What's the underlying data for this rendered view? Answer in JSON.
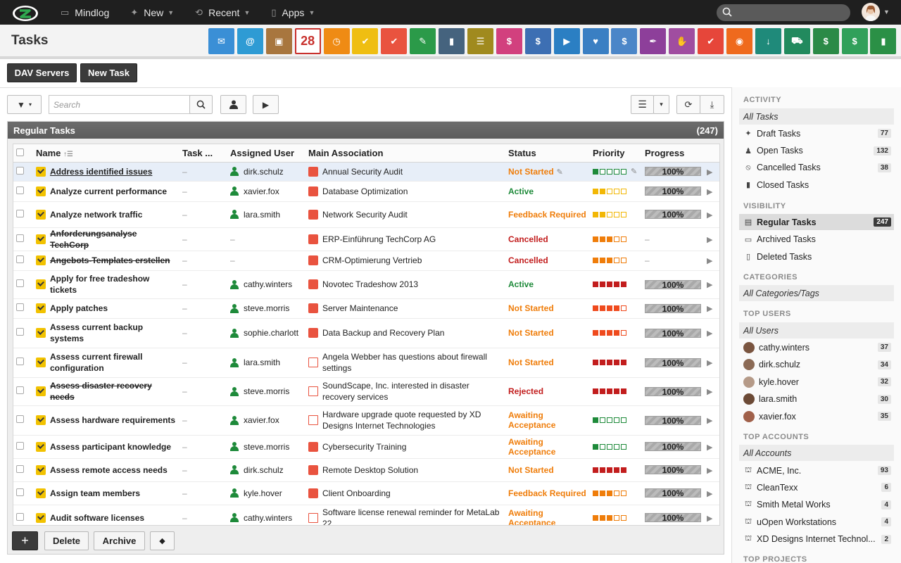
{
  "topbar": {
    "nav": [
      {
        "label": "Mindlog",
        "icon": "monitor-icon",
        "caret": false
      },
      {
        "label": "New",
        "icon": "sparkle-icon",
        "caret": true
      },
      {
        "label": "Recent",
        "icon": "history-icon",
        "caret": true
      },
      {
        "label": "Apps",
        "icon": "tablet-icon",
        "caret": true
      }
    ],
    "search_placeholder": ""
  },
  "header": {
    "title": "Tasks",
    "apps": [
      {
        "name": "mail-app-icon",
        "color": "#3a8fd6",
        "glyph": "✉"
      },
      {
        "name": "address-app-icon",
        "color": "#2e9bd4",
        "glyph": "@"
      },
      {
        "name": "contacts-app-icon",
        "color": "#a8763e",
        "glyph": "▣"
      },
      {
        "name": "calendar-app-icon",
        "color": "#c8302c",
        "glyph": "28"
      },
      {
        "name": "timer-app-icon",
        "color": "#ef8b14",
        "glyph": "◷"
      },
      {
        "name": "tasks-app-icon",
        "color": "#efbe12",
        "glyph": "✔"
      },
      {
        "name": "projects-app-icon",
        "color": "#e9533f",
        "glyph": "✔"
      },
      {
        "name": "notes-app-icon",
        "color": "#2b9a49",
        "glyph": "✎"
      },
      {
        "name": "bookmarks-app-icon",
        "color": "#45637e",
        "glyph": "▮"
      },
      {
        "name": "docs-app-icon",
        "color": "#a08a1e",
        "glyph": "☰"
      },
      {
        "name": "helpdesk-app-icon",
        "color": "#d2407e",
        "glyph": "$"
      },
      {
        "name": "finance-app-icon",
        "color": "#3d6fb3",
        "glyph": "$"
      },
      {
        "name": "shipping-app-icon",
        "color": "#2b7fc3",
        "glyph": "▶"
      },
      {
        "name": "support-app-icon",
        "color": "#3a7fc3",
        "glyph": "♥"
      },
      {
        "name": "money-app-icon",
        "color": "#4b86c8",
        "glyph": "$"
      },
      {
        "name": "contracts-app-icon",
        "color": "#8d3f9a",
        "glyph": "✒"
      },
      {
        "name": "deals-app-icon",
        "color": "#a04da0",
        "glyph": "✋"
      },
      {
        "name": "quotes-app-icon",
        "color": "#e6463a",
        "glyph": "✔"
      },
      {
        "name": "broadcast-app-icon",
        "color": "#ef6a1d",
        "glyph": "◉"
      },
      {
        "name": "downloads-app-icon",
        "color": "#1f8a7a",
        "glyph": "↓"
      },
      {
        "name": "shop-app-icon",
        "color": "#228a5e",
        "glyph": "⛟"
      },
      {
        "name": "cash-app-icon",
        "color": "#2b8a47",
        "glyph": "$"
      },
      {
        "name": "pricing-app-icon",
        "color": "#31a05a",
        "glyph": "$"
      },
      {
        "name": "database-app-icon",
        "color": "#2b9046",
        "glyph": "▮"
      }
    ]
  },
  "toolbar": {
    "dav_label": "DAV Servers",
    "new_task_label": "New Task",
    "search_placeholder": "Search"
  },
  "panel": {
    "title": "Regular Tasks",
    "count": "(247)"
  },
  "table": {
    "headers": {
      "name": "Name",
      "task": "Task ...",
      "user": "Assigned User",
      "assoc": "Main Association",
      "status": "Status",
      "priority": "Priority",
      "progress": "Progress"
    },
    "rows": [
      {
        "name": "Address identified issues",
        "style": "ul",
        "task": "–",
        "user": "dirk.schulz",
        "assoc": "Annual Security Audit",
        "assoc_type": "project",
        "status": "Not Started",
        "status_color": "#ef7d0a",
        "priority": 1,
        "prio_color": "#1e8a3a",
        "progress": "100%",
        "selected": true,
        "pencil": true
      },
      {
        "name": "Analyze current performance",
        "style": "",
        "task": "–",
        "user": "xavier.fox",
        "assoc": "Database Optimization",
        "assoc_type": "project",
        "status": "Active",
        "status_color": "#1e8a3a",
        "priority": 2,
        "prio_color": "#f2b705",
        "progress": "100%"
      },
      {
        "name": "Analyze network traffic",
        "style": "",
        "task": "–",
        "user": "lara.smith",
        "assoc": "Network Security Audit",
        "assoc_type": "project",
        "status": "Feedback Required",
        "status_color": "#ef7d0a",
        "priority": 2,
        "prio_color": "#f2b705",
        "progress": "100%"
      },
      {
        "name": "Anforderungsanalyse TechCorp",
        "style": "st",
        "task": "–",
        "user": "–",
        "assoc": "ERP-Einführung TechCorp AG",
        "assoc_type": "project",
        "status": "Cancelled",
        "status_color": "#c21d1d",
        "priority": 3,
        "prio_color": "#ef7d0a",
        "progress": "–"
      },
      {
        "name": "Angebots-Templates erstellen",
        "style": "st",
        "task": "–",
        "user": "–",
        "assoc": "CRM-Optimierung Vertrieb",
        "assoc_type": "project",
        "status": "Cancelled",
        "status_color": "#c21d1d",
        "priority": 3,
        "prio_color": "#ef7d0a",
        "progress": "–"
      },
      {
        "name": "Apply for free tradeshow tickets",
        "style": "",
        "task": "–",
        "user": "cathy.winters",
        "assoc": "Novotec Tradeshow 2013",
        "assoc_type": "project",
        "status": "Active",
        "status_color": "#1e8a3a",
        "priority": 5,
        "prio_color": "#c21d1d",
        "progress": "100%"
      },
      {
        "name": "Apply patches",
        "style": "",
        "task": "–",
        "user": "steve.morris",
        "assoc": "Server Maintenance",
        "assoc_type": "project",
        "status": "Not Started",
        "status_color": "#ef7d0a",
        "priority": 4,
        "prio_color": "#ef4a1d",
        "progress": "100%"
      },
      {
        "name": "Assess current backup systems",
        "style": "",
        "task": "–",
        "user": "sophie.charlott",
        "assoc": "Data Backup and Recovery Plan",
        "assoc_type": "project",
        "status": "Not Started",
        "status_color": "#ef7d0a",
        "priority": 4,
        "prio_color": "#ef4a1d",
        "progress": "100%"
      },
      {
        "name": "Assess current firewall configuration",
        "style": "",
        "task": "–",
        "user": "lara.smith",
        "assoc": "Angela Webber has questions about firewall settings",
        "assoc_type": "doc",
        "status": "Not Started",
        "status_color": "#ef7d0a",
        "priority": 5,
        "prio_color": "#c21d1d",
        "progress": "100%"
      },
      {
        "name": "Assess disaster recovery needs",
        "style": "st",
        "task": "–",
        "user": "steve.morris",
        "assoc": "SoundScape, Inc. interested in disaster recovery services",
        "assoc_type": "doc",
        "status": "Rejected",
        "status_color": "#c21d1d",
        "priority": 5,
        "prio_color": "#c21d1d",
        "progress": "100%"
      },
      {
        "name": "Assess hardware requirements",
        "style": "",
        "task": "–",
        "user": "xavier.fox",
        "assoc": "Hardware upgrade quote requested by XD Designs Internet Technologies",
        "assoc_type": "doc",
        "status": "Awaiting Acceptance",
        "status_color": "#ef7d0a",
        "priority": 1,
        "prio_color": "#1e8a3a",
        "progress": "100%"
      },
      {
        "name": "Assess participant knowledge",
        "style": "",
        "task": "–",
        "user": "steve.morris",
        "assoc": "Cybersecurity Training",
        "assoc_type": "project",
        "status": "Awaiting Acceptance",
        "status_color": "#ef7d0a",
        "priority": 1,
        "prio_color": "#1e8a3a",
        "progress": "100%"
      },
      {
        "name": "Assess remote access needs",
        "style": "",
        "task": "–",
        "user": "dirk.schulz",
        "assoc": "Remote Desktop Solution",
        "assoc_type": "project",
        "status": "Not Started",
        "status_color": "#ef7d0a",
        "priority": 5,
        "prio_color": "#c21d1d",
        "progress": "100%"
      },
      {
        "name": "Assign team members",
        "style": "",
        "task": "–",
        "user": "kyle.hover",
        "assoc": "Client Onboarding",
        "assoc_type": "project",
        "status": "Feedback Required",
        "status_color": "#ef7d0a",
        "priority": 3,
        "prio_color": "#ef7d0a",
        "progress": "100%"
      },
      {
        "name": "Audit software licenses",
        "style": "",
        "task": "–",
        "user": "cathy.winters",
        "assoc": "Software license renewal reminder for MetaLab 22",
        "assoc_type": "doc",
        "status": "Awaiting Acceptance",
        "status_color": "#ef7d0a",
        "priority": 3,
        "prio_color": "#ef7d0a",
        "progress": "100%"
      }
    ]
  },
  "bottom": {
    "add": "+",
    "delete": "Delete",
    "archive": "Archive"
  },
  "sidebar": {
    "activity_label": "ACTIVITY",
    "activity": [
      {
        "label": "All Tasks",
        "kind": "all"
      },
      {
        "label": "Draft Tasks",
        "count": "77",
        "icon": "✦"
      },
      {
        "label": "Open Tasks",
        "count": "132",
        "icon": "♟"
      },
      {
        "label": "Cancelled Tasks",
        "count": "38",
        "icon": "⦸"
      },
      {
        "label": "Closed Tasks",
        "icon": "▮"
      }
    ],
    "visibility_label": "VISIBILITY",
    "visibility": [
      {
        "label": "Regular Tasks",
        "count": "247",
        "icon": "▤",
        "kind": "act"
      },
      {
        "label": "Archived Tasks",
        "icon": "▭"
      },
      {
        "label": "Deleted Tasks",
        "icon": "▯"
      }
    ],
    "categories_label": "CATEGORIES",
    "categories_all": "All Categories/Tags",
    "users_label": "TOP USERS",
    "users_all": "All Users",
    "users": [
      {
        "label": "cathy.winters",
        "count": "37",
        "color": "#7a5540"
      },
      {
        "label": "dirk.schulz",
        "count": "34",
        "color": "#8b6a55"
      },
      {
        "label": "kyle.hover",
        "count": "32",
        "color": "#b59a88"
      },
      {
        "label": "lara.smith",
        "count": "30",
        "color": "#6c4a36"
      },
      {
        "label": "xavier.fox",
        "count": "35",
        "color": "#a0604a"
      }
    ],
    "accounts_label": "TOP ACCOUNTS",
    "accounts_all": "All Accounts",
    "accounts": [
      {
        "label": "ACME, Inc.",
        "count": "93"
      },
      {
        "label": "CleanTexx",
        "count": "6"
      },
      {
        "label": "Smith Metal Works",
        "count": "4"
      },
      {
        "label": "uOpen Workstations",
        "count": "4"
      },
      {
        "label": "XD Designs Internet Technol...",
        "count": "2"
      }
    ],
    "projects_label": "TOP PROJECTS"
  }
}
